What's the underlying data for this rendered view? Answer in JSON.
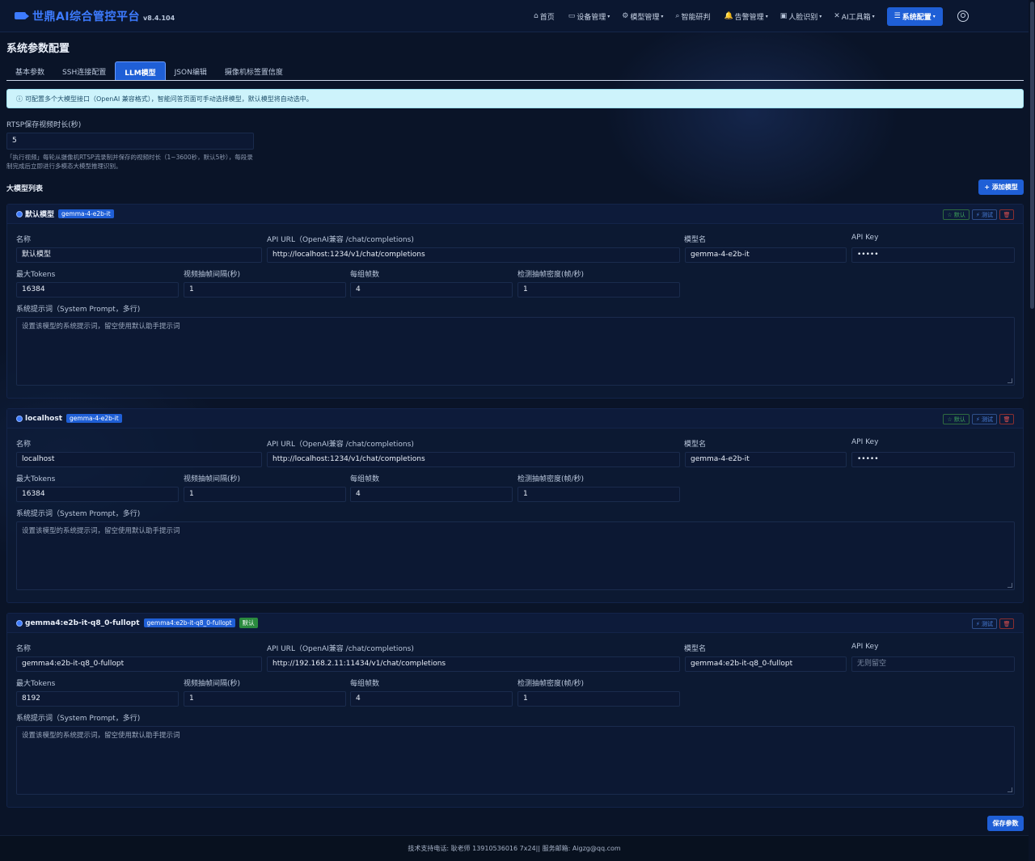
{
  "brand": {
    "title": "世鼎AI综合管控平台",
    "version": "v8.4.104"
  },
  "nav": {
    "items": [
      {
        "icon": "⌂",
        "label": "首页",
        "caret": ""
      },
      {
        "icon": "▭",
        "label": "设备管理",
        "caret": "▾"
      },
      {
        "icon": "⚙",
        "label": "模型管理",
        "caret": "▾"
      },
      {
        "icon": "⌕",
        "label": "智能研判",
        "caret": ""
      },
      {
        "icon": "🔔",
        "label": "告警管理",
        "caret": "▾"
      },
      {
        "icon": "▣",
        "label": "人脸识别",
        "caret": "▾"
      },
      {
        "icon": "✕",
        "label": "AI工具箱",
        "caret": "▾"
      }
    ],
    "active": {
      "icon": "☰",
      "label": "系统配置",
      "caret": "▾"
    }
  },
  "page": {
    "title": "系统参数配置"
  },
  "tabs": [
    "基本参数",
    "SSH连接配置",
    "LLM模型",
    "JSON编辑",
    "摄像机标签置信度"
  ],
  "info": {
    "icon": "ⓘ",
    "text": "可配置多个大模型接口（OpenAI 兼容格式），智能问答页面可手动选择模型，默认模型将自动选中。"
  },
  "rtsp": {
    "label": "RTSP保存视频时长(秒)",
    "value": "5",
    "hint": "「执行视频」每轮从摄像机RTSP流录制并保存的视频时长（1~3600秒，默认5秒），每段录制完成后立即进行多模态大模型推理识别。"
  },
  "section": {
    "title": "大模型列表",
    "add_label": "+ 添加模型"
  },
  "labels": {
    "name": "名称",
    "api_url": "API URL（OpenAI兼容 /chat/completions)",
    "model": "模型名",
    "api_key": "API Key",
    "max_tokens": "最大Tokens",
    "frame_interval": "视频抽帧间隔(秒)",
    "frames_per_group": "每组帧数",
    "detect_density": "检测抽帧密度(帧/秒)",
    "system_prompt": "系统提示词（System Prompt，多行)"
  },
  "actions": {
    "fav": "☆ 默认",
    "test": "⚡ 测试",
    "del": "🗑"
  },
  "models": [
    {
      "title": "默认模型",
      "badge": "gemma-4-e2b-it",
      "default_badge": "",
      "name": "默认模型",
      "api_url": "http://localhost:1234/v1/chat/completions",
      "model": "gemma-4-e2b-it",
      "api_key": "•••••",
      "api_key_placeholder": "",
      "max_tokens": "16384",
      "frame_interval": "1",
      "frames_per_group": "4",
      "detect_density": "1",
      "prompt_placeholder": "设置该模型的系统提示词，留空使用默认助手提示词"
    },
    {
      "title": "localhost",
      "badge": "gemma-4-e2b-it",
      "default_badge": "",
      "name": "localhost",
      "api_url": "http://localhost:1234/v1/chat/completions",
      "model": "gemma-4-e2b-it",
      "api_key": "•••••",
      "api_key_placeholder": "",
      "max_tokens": "16384",
      "frame_interval": "1",
      "frames_per_group": "4",
      "detect_density": "1",
      "prompt_placeholder": "设置该模型的系统提示词，留空使用默认助手提示词"
    },
    {
      "title": "gemma4:e2b-it-q8_0-fullopt",
      "badge": "gemma4:e2b-it-q8_0-fullopt",
      "default_badge": "默认",
      "name": "gemma4:e2b-it-q8_0-fullopt",
      "api_url": "http://192.168.2.11:11434/v1/chat/completions",
      "model": "gemma4:e2b-it-q8_0-fullopt",
      "api_key": "",
      "api_key_placeholder": "无则留空",
      "max_tokens": "8192",
      "frame_interval": "1",
      "frames_per_group": "4",
      "detect_density": "1",
      "prompt_placeholder": "设置该模型的系统提示词，留空使用默认助手提示词"
    }
  ],
  "save_label": "保存参数",
  "footer": "技术支持电话: 耿老师 13910536016 7x24|| 服务邮箱: Aigzg@qq.com"
}
